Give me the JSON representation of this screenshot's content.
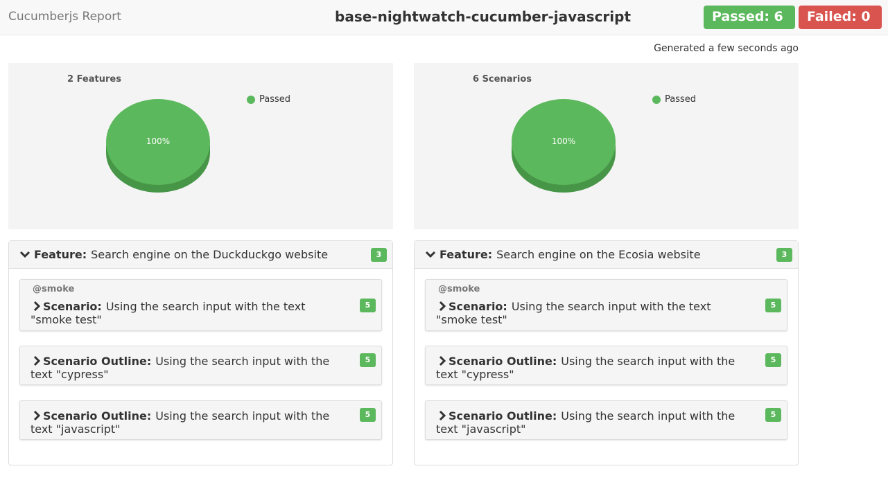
{
  "header": {
    "brand": "Cucumberjs Report",
    "project": "base-nightwatch-cucumber-javascript",
    "passed_label": "Passed: 6",
    "failed_label": "Failed: 0",
    "passed_color": "#5cb85c",
    "failed_color": "#d9534f"
  },
  "generated": "Generated a few seconds ago",
  "charts": [
    {
      "title": "2 Features",
      "center_label": "100%",
      "legend": [
        {
          "label": "Passed",
          "color": "#5cb85c"
        }
      ],
      "chart_data": {
        "type": "pie",
        "categories": [
          "Passed"
        ],
        "values": [
          100
        ],
        "title": "2 Features"
      }
    },
    {
      "title": "6 Scenarios",
      "center_label": "100%",
      "legend": [
        {
          "label": "Passed",
          "color": "#5cb85c"
        }
      ],
      "chart_data": {
        "type": "pie",
        "categories": [
          "Passed"
        ],
        "values": [
          100
        ],
        "title": "6 Scenarios"
      }
    }
  ],
  "features": [
    {
      "keyword": "Feature:",
      "name": "Search engine on the Duckduckgo website",
      "count": "3",
      "scenarios": [
        {
          "tag": "@smoke",
          "keyword": "Scenario:",
          "line1": "Using the search input with the text",
          "line2": "\"smoke test\"",
          "count": "5"
        },
        {
          "tag": "",
          "keyword": "Scenario Outline:",
          "line1": "Using the search input with the",
          "line2": "text \"cypress\"",
          "count": "5"
        },
        {
          "tag": "",
          "keyword": "Scenario Outline:",
          "line1": "Using the search input with the",
          "line2": "text \"javascript\"",
          "count": "5"
        }
      ]
    },
    {
      "keyword": "Feature:",
      "name": "Search engine on the Ecosia website",
      "count": "3",
      "scenarios": [
        {
          "tag": "@smoke",
          "keyword": "Scenario:",
          "line1": "Using the search input with the text",
          "line2": "\"smoke test\"",
          "count": "5"
        },
        {
          "tag": "",
          "keyword": "Scenario Outline:",
          "line1": "Using the search input with the",
          "line2": "text \"cypress\"",
          "count": "5"
        },
        {
          "tag": "",
          "keyword": "Scenario Outline:",
          "line1": "Using the search input with the",
          "line2": "text \"javascript\"",
          "count": "5"
        }
      ]
    }
  ]
}
